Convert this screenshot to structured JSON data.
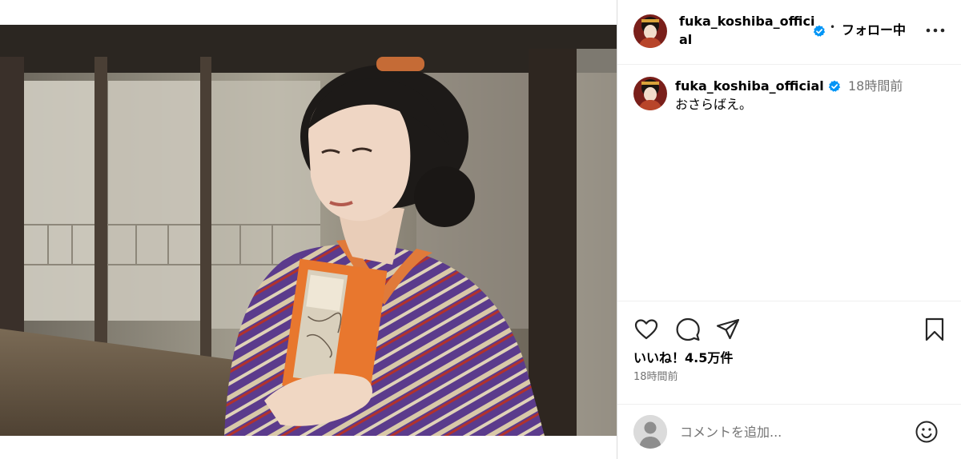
{
  "colors": {
    "verified_badge": "#0095f6",
    "text_primary": "#000000",
    "text_secondary": "#737373",
    "divider": "#dbdbdb"
  },
  "post": {
    "image": {
      "description_icon": "photo-of-woman-in-purple-striped-kimono-holding-orange-book"
    },
    "header": {
      "username": "fuka_koshiba_official",
      "verified_icon": "verified-badge-icon",
      "separator": "•",
      "follow_label": "フォロー中",
      "more_icon": "more-options-icon"
    },
    "caption": {
      "username": "fuka_koshiba_official",
      "time": "18時間前",
      "text": "おさらばえ。"
    },
    "actions": {
      "like_icon": "heart-icon",
      "comment_icon": "comment-bubble-icon",
      "share_icon": "paper-plane-icon",
      "save_icon": "bookmark-icon",
      "likes_text": "いいね！4.5万件",
      "date_text": "18時間前"
    },
    "comment_box": {
      "placeholder": "コメントを追加...",
      "emoji_icon": "smiley-icon"
    }
  }
}
